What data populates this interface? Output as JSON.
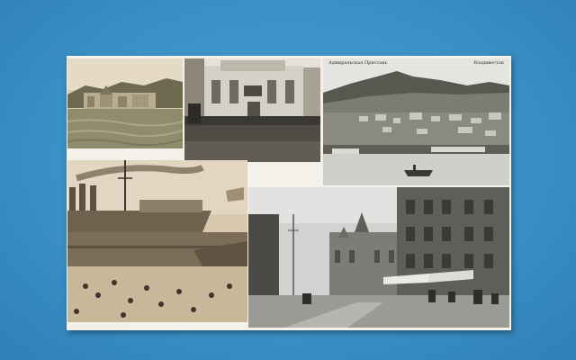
{
  "scene": {
    "background_color": "#3f95c9",
    "card_color": "#f4f1ea"
  },
  "postcard": {
    "photos": [
      {
        "subject": "harbor with palace on hill",
        "tone": "sepia"
      },
      {
        "subject": "theater building facade with crowd",
        "tone": "sepia"
      },
      {
        "subject": "panorama of bay city with hills",
        "caption_left": "Адмиральская Пристань",
        "caption_right": "Владивосток",
        "tone": "sepia"
      },
      {
        "subject": "warship with smokestacks at crowded pier",
        "tone": "sepia"
      },
      {
        "subject": "street with ornate buildings and carriages",
        "tone": "gray"
      }
    ]
  }
}
